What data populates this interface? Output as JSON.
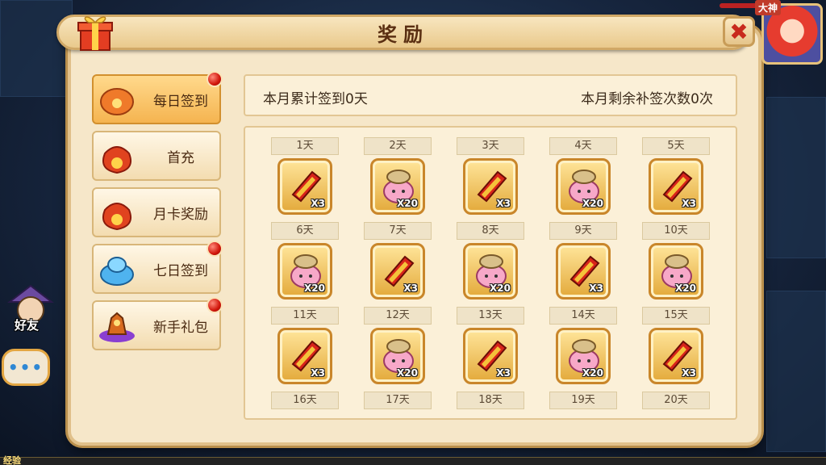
{
  "window": {
    "title": "奖励",
    "avatar_badge": "大神"
  },
  "menu": {
    "items": [
      {
        "label": "每日签到",
        "icon": "lantern-icon",
        "active": true,
        "badge": true
      },
      {
        "label": "首充",
        "icon": "money-bag-icon",
        "active": false,
        "badge": false
      },
      {
        "label": "月卡奖励",
        "icon": "money-bag-icon",
        "active": false,
        "badge": false
      },
      {
        "label": "七日签到",
        "icon": "crystal-icon",
        "active": false,
        "badge": true
      },
      {
        "label": "新手礼包",
        "icon": "treasure-icon",
        "active": false,
        "badge": true
      }
    ]
  },
  "info": {
    "left": "本月累计签到0天",
    "right": "本月剩余补签次数0次"
  },
  "days": [
    {
      "label": "1天",
      "item": "red-scroll-icon",
      "qty": "X3"
    },
    {
      "label": "2天",
      "item": "pink-pouch-icon",
      "qty": "X20"
    },
    {
      "label": "3天",
      "item": "red-scroll-icon",
      "qty": "X3"
    },
    {
      "label": "4天",
      "item": "pink-pouch-icon",
      "qty": "X20"
    },
    {
      "label": "5天",
      "item": "red-scroll-icon",
      "qty": "X3"
    },
    {
      "label": "6天",
      "item": "pink-pouch-icon",
      "qty": "X20"
    },
    {
      "label": "7天",
      "item": "red-scroll-icon",
      "qty": "X3"
    },
    {
      "label": "8天",
      "item": "pink-pouch-icon",
      "qty": "X20"
    },
    {
      "label": "9天",
      "item": "red-scroll-icon",
      "qty": "X3"
    },
    {
      "label": "10天",
      "item": "pink-pouch-icon",
      "qty": "X20"
    },
    {
      "label": "11天",
      "item": "red-scroll-icon",
      "qty": "X3"
    },
    {
      "label": "12天",
      "item": "pink-pouch-icon",
      "qty": "X20"
    },
    {
      "label": "13天",
      "item": "red-scroll-icon",
      "qty": "X3"
    },
    {
      "label": "14天",
      "item": "pink-pouch-icon",
      "qty": "X20"
    },
    {
      "label": "15天",
      "item": "red-scroll-icon",
      "qty": "X3"
    },
    {
      "label": "16天",
      "item": "",
      "qty": ""
    },
    {
      "label": "17天",
      "item": "",
      "qty": ""
    },
    {
      "label": "18天",
      "item": "",
      "qty": ""
    },
    {
      "label": "19天",
      "item": "",
      "qty": ""
    },
    {
      "label": "20天",
      "item": "",
      "qty": ""
    }
  ],
  "side": {
    "friend_label": "好友",
    "chat_label": "•••",
    "exp_label": "经验"
  },
  "colors": {
    "panel": "#f6e7c9",
    "accent": "#f5b450",
    "close": "#c82a1d",
    "badge": "#d1160b"
  }
}
